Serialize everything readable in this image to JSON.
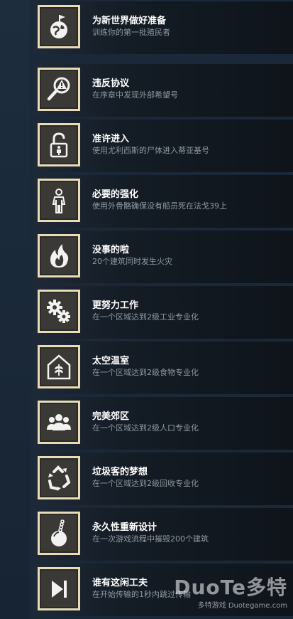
{
  "achievements": [
    {
      "title": "为新世界做好准备",
      "description": "训练你的第一批殖民者",
      "icon": "planet-flag-icon"
    },
    {
      "title": "违反协议",
      "description": "在序章中发现外部希望号",
      "icon": "magnifier-warning-icon"
    },
    {
      "title": "准许进入",
      "description": "使用尤利西斯的尸体进入蒂亚基号",
      "icon": "unlocked-padlock-icon"
    },
    {
      "title": "必要的强化",
      "description": "使用外骨骼确保没有船员死在法戈39上",
      "icon": "exoskeleton-icon"
    },
    {
      "title": "没事的啦",
      "description": "20个建筑同时发生火灾",
      "icon": "fire-icon"
    },
    {
      "title": "更努力工作",
      "description": "在一个区域达到2级工业专业化",
      "icon": "gears-icon"
    },
    {
      "title": "太空温室",
      "description": "在一个区域达到2级食物专业化",
      "icon": "greenhouse-icon"
    },
    {
      "title": "完美郊区",
      "description": "在一个区域达到2级人口专业化",
      "icon": "people-icon"
    },
    {
      "title": "垃圾客的梦想",
      "description": "在一个区域达到2级回收专业化",
      "icon": "recycle-icon"
    },
    {
      "title": "永久性重新设计",
      "description": "在一次游戏流程中摧毁200个建筑",
      "icon": "wrecking-ball-icon"
    },
    {
      "title": "谁有这闲工夫",
      "description": "在开始传输的1秒内跳过传输",
      "icon": "skip-icon"
    }
  ],
  "watermark": {
    "brand": "DuoTe多特",
    "site": "多特游戏 Duotegame.com"
  }
}
